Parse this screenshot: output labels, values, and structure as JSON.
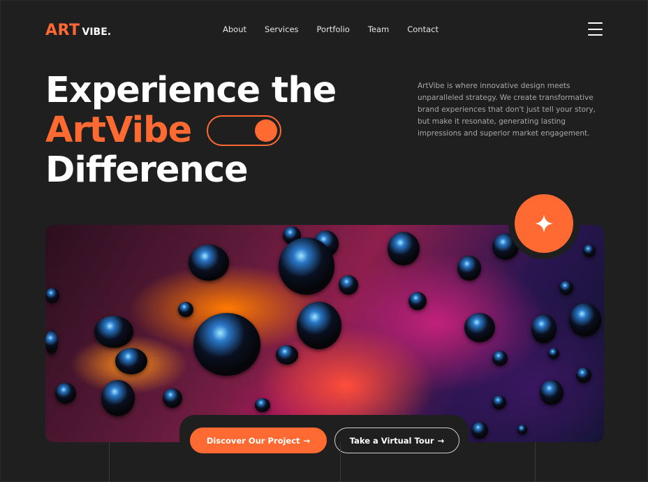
{
  "brand": {
    "logo_art": "ART",
    "logo_vibe": "VIBE."
  },
  "nav": {
    "items": [
      {
        "label": "About"
      },
      {
        "label": "Services"
      },
      {
        "label": "Portfolio"
      },
      {
        "label": "Team"
      },
      {
        "label": "Contact"
      }
    ]
  },
  "hero": {
    "line1": "Experience the",
    "line2": "ArtVibe",
    "line3": "Difference",
    "intro": "ArtVibe is where innovative design meets unparalleled strategy. We create transformative brand experiences that don't just tell your story, but make it resonate, generating lasting impressions and superior market engagement."
  },
  "cta": {
    "primary_label": "Discover Our Project",
    "secondary_label": "Take a Virtual Tour",
    "arrow": "→"
  },
  "colors": {
    "accent": "#ff6a33",
    "background": "#1f1f1f",
    "text": "#ffffff",
    "muted": "#a8a8a8"
  },
  "icons": {
    "menu": "hamburger-icon",
    "badge": "sparkle-star-icon",
    "arrow": "arrow-right-icon"
  }
}
